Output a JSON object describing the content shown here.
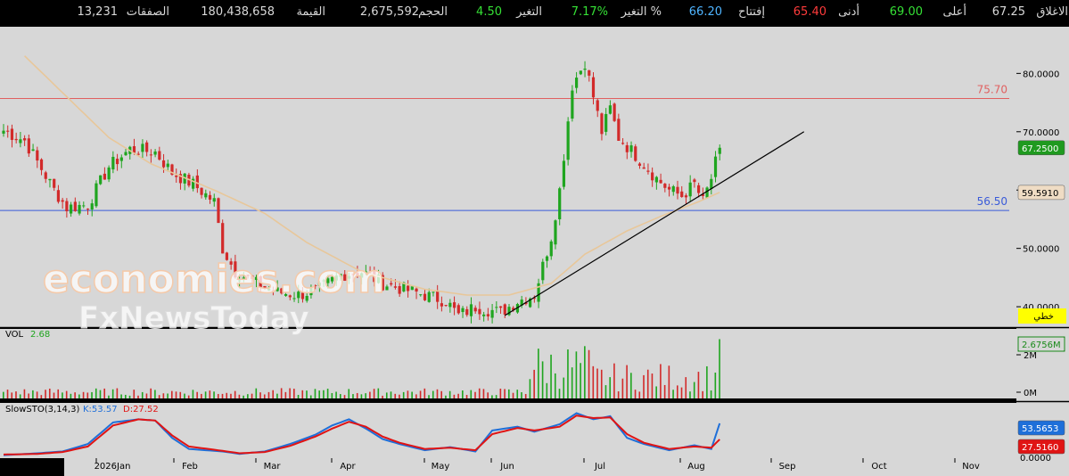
{
  "header": [
    {
      "label": "الاغلاق",
      "value": "67.25",
      "vcolor": "#d8d8d8"
    },
    {
      "label": "أعلى",
      "value": "69.00",
      "vcolor": "#35e035"
    },
    {
      "label": "أدنى",
      "value": "65.40",
      "vcolor": "#ff3b3b"
    },
    {
      "label": "إفتتاح",
      "value": "66.20",
      "vcolor": "#4fb4ff"
    },
    {
      "label": "التغير %",
      "value": "7.17%",
      "vcolor": "#35e035"
    },
    {
      "label": "التغير",
      "value": "4.50",
      "vcolor": "#35e035"
    },
    {
      "label": "الحجم",
      "value": "2,675,592",
      "vcolor": "#d8d8d8"
    },
    {
      "label": "القيمة",
      "value": "180,438,658",
      "vcolor": "#d8d8d8"
    },
    {
      "label": "الصفقات",
      "value": "13,231",
      "vcolor": "#d8d8d8"
    }
  ],
  "colors": {
    "up": "#1fa51f",
    "down": "#d22a2a",
    "ma": "#e8c79a",
    "bg": "#d7d7d7",
    "k": "#1e6fd9",
    "d": "#e01414"
  },
  "chart_data": {
    "type": "candlestick",
    "x_months": [
      "2026Jan",
      "Feb",
      "Mar",
      "Apr",
      "May",
      "Jun",
      "Jul",
      "Aug",
      "Sep",
      "Oct",
      "Nov"
    ],
    "price_axis": {
      "ticks": [
        "80.0000",
        "70.0000",
        "60.0000",
        "50.0000",
        "40.0000"
      ],
      "ylim": [
        36.5,
        88
      ]
    },
    "last_price": "67.2500",
    "ma_value": "59.5910",
    "scale_label": "خطي",
    "horizontal_levels": [
      {
        "label": "75.70",
        "value": 75.7,
        "color": "#e06060"
      },
      {
        "label": "56.50",
        "value": 56.5,
        "color": "#3a5bd9"
      }
    ],
    "trendline": {
      "from": [
        119,
        38.5
      ],
      "to": [
        190,
        70
      ]
    },
    "anchors": [
      [
        0,
        70.2
      ],
      [
        5,
        68.5
      ],
      [
        12,
        60
      ],
      [
        15,
        57
      ],
      [
        20,
        57.5
      ],
      [
        25,
        64
      ],
      [
        30,
        67
      ],
      [
        36,
        66.5
      ],
      [
        40,
        63
      ],
      [
        45,
        61
      ],
      [
        50,
        58
      ],
      [
        52,
        50
      ],
      [
        55,
        46
      ],
      [
        60,
        44
      ],
      [
        65,
        42.5
      ],
      [
        70,
        42
      ],
      [
        75,
        43
      ],
      [
        80,
        45.5
      ],
      [
        85,
        46
      ],
      [
        90,
        44
      ],
      [
        95,
        43
      ],
      [
        100,
        42
      ],
      [
        105,
        41
      ],
      [
        108,
        38.5
      ],
      [
        112,
        40
      ],
      [
        118,
        39
      ],
      [
        122,
        41
      ],
      [
        126,
        42
      ],
      [
        130,
        52
      ],
      [
        132,
        60
      ],
      [
        135,
        78
      ],
      [
        138,
        82
      ],
      [
        140,
        76
      ],
      [
        142,
        70
      ],
      [
        144,
        74
      ],
      [
        146,
        69
      ],
      [
        150,
        66
      ],
      [
        155,
        62
      ],
      [
        158,
        60
      ],
      [
        161,
        59
      ],
      [
        164,
        61
      ],
      [
        166,
        58
      ],
      [
        168,
        62
      ],
      [
        170,
        67.25
      ]
    ],
    "ma_anchors": [
      [
        5,
        83
      ],
      [
        15,
        76
      ],
      [
        25,
        69
      ],
      [
        35,
        64.5
      ],
      [
        50,
        60
      ],
      [
        62,
        56
      ],
      [
        72,
        51
      ],
      [
        85,
        46
      ],
      [
        100,
        43
      ],
      [
        110,
        42
      ],
      [
        120,
        42
      ],
      [
        130,
        44
      ],
      [
        138,
        49
      ],
      [
        148,
        53
      ],
      [
        156,
        55.5
      ],
      [
        165,
        58
      ],
      [
        170,
        59.6
      ]
    ],
    "volume": {
      "label": "VOL",
      "value": "2.68",
      "last_tag": "2.6756M",
      "ticks": [
        "2M",
        "0M"
      ],
      "max": 2.9
    },
    "stoch": {
      "label": "SlowSTO(3,14,3)",
      "k_label": "K:53.57",
      "d_label": "D:27.52",
      "k_tag": "53.5653",
      "d_tag": "27.5160",
      "zero": "0.0000",
      "k_anchors": [
        [
          0,
          2
        ],
        [
          8,
          5
        ],
        [
          14,
          8
        ],
        [
          20,
          20
        ],
        [
          26,
          55
        ],
        [
          32,
          60
        ],
        [
          36,
          58
        ],
        [
          40,
          30
        ],
        [
          44,
          12
        ],
        [
          52,
          8
        ],
        [
          56,
          4
        ],
        [
          62,
          8
        ],
        [
          68,
          20
        ],
        [
          74,
          35
        ],
        [
          78,
          50
        ],
        [
          82,
          60
        ],
        [
          86,
          45
        ],
        [
          90,
          28
        ],
        [
          94,
          20
        ],
        [
          100,
          10
        ],
        [
          106,
          15
        ],
        [
          112,
          8
        ],
        [
          116,
          42
        ],
        [
          122,
          48
        ],
        [
          126,
          40
        ],
        [
          132,
          52
        ],
        [
          136,
          70
        ],
        [
          140,
          60
        ],
        [
          144,
          65
        ],
        [
          148,
          30
        ],
        [
          152,
          20
        ],
        [
          158,
          10
        ],
        [
          164,
          18
        ],
        [
          168,
          12
        ],
        [
          170,
          53.57
        ]
      ],
      "d_anchors": [
        [
          0,
          3
        ],
        [
          8,
          4
        ],
        [
          14,
          7
        ],
        [
          20,
          16
        ],
        [
          26,
          50
        ],
        [
          32,
          60
        ],
        [
          36,
          58
        ],
        [
          40,
          34
        ],
        [
          44,
          16
        ],
        [
          52,
          9
        ],
        [
          56,
          5
        ],
        [
          62,
          7
        ],
        [
          68,
          17
        ],
        [
          74,
          32
        ],
        [
          78,
          45
        ],
        [
          82,
          56
        ],
        [
          86,
          48
        ],
        [
          90,
          32
        ],
        [
          94,
          22
        ],
        [
          100,
          12
        ],
        [
          106,
          14
        ],
        [
          112,
          10
        ],
        [
          116,
          36
        ],
        [
          122,
          46
        ],
        [
          126,
          42
        ],
        [
          132,
          48
        ],
        [
          136,
          66
        ],
        [
          140,
          62
        ],
        [
          144,
          63
        ],
        [
          148,
          36
        ],
        [
          152,
          22
        ],
        [
          158,
          12
        ],
        [
          164,
          16
        ],
        [
          168,
          14
        ],
        [
          170,
          27.52
        ]
      ]
    }
  }
}
